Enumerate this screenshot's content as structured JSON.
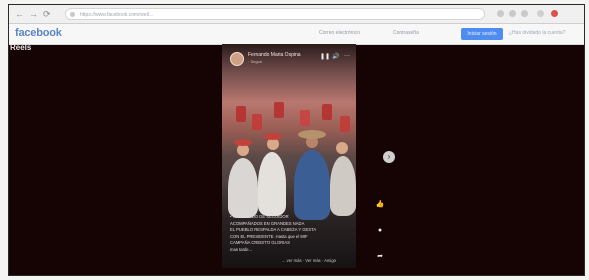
{
  "browser": {
    "back_glyph": "←",
    "forward_glyph": "→",
    "reload_glyph": "⟳",
    "url": "https://www.facebook.com/reel/..."
  },
  "header": {
    "logo": "facebook",
    "links": [
      "Correo electrónico",
      "Contraseña"
    ],
    "login_label": "Iniciar sesión",
    "signup_label": "¿Has olvidado la cuenta?"
  },
  "reels": {
    "section_title": "Reels",
    "author": "Fernando Maria Ospina",
    "author_sub": "· Seguir",
    "controls": [
      "❚❚",
      "🔊",
      "···"
    ],
    "caption_lines": [
      "• VA SEGUIDO DE SEGUIDOR",
      "ACOMPAÑADOS EN GRANDES NADA",
      "EL PUEBLO RESPALDA A CABEZA Y GESTA",
      "CON EL PRESIDENTE. Hasta que el MIF",
      "CAMPAÑA CREDITO GLORIAS",
      "mas tarde..."
    ],
    "see_more": "... ver más · Ver más · Amigo"
  },
  "colors": {
    "brand": "#5b86c8",
    "login_button": "#4f8cf0",
    "reels_background": "#160405"
  },
  "icons": [
    "arrow-left-icon",
    "arrow-right-icon",
    "reload-icon",
    "lock-icon",
    "next-chevron-icon",
    "like-icon",
    "comment-icon",
    "share-icon"
  ]
}
